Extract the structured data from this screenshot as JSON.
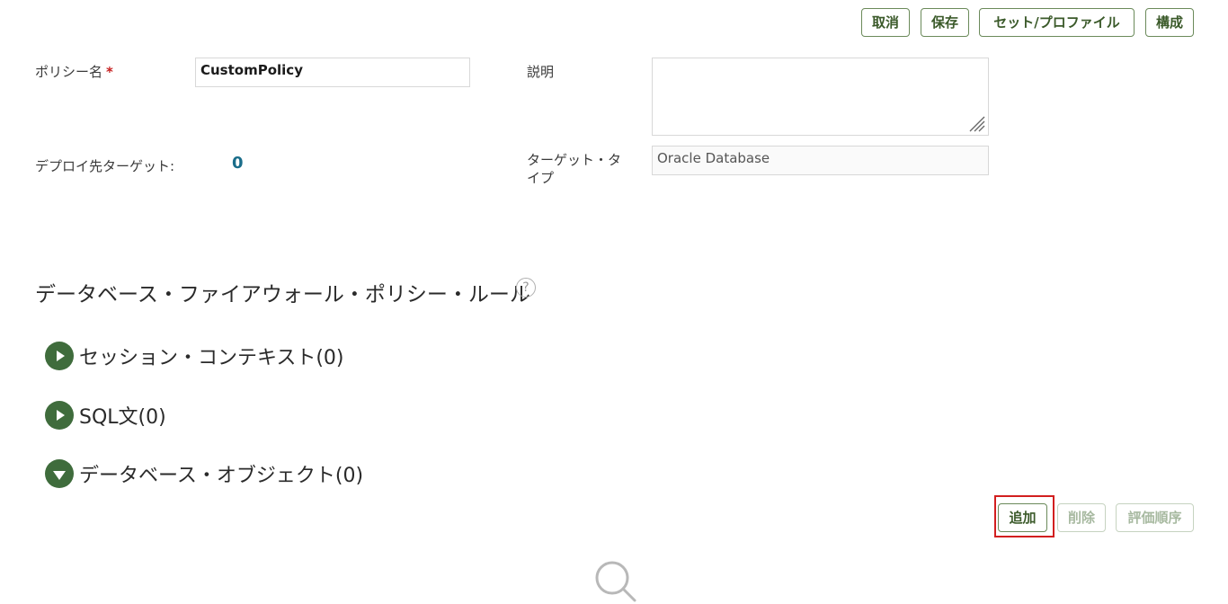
{
  "toolbar": {
    "cancel_label": "取消",
    "save_label": "保存",
    "set_profile_label": "セット/プロファイル",
    "configure_label": "構成"
  },
  "form": {
    "policy_name_label": "ポリシー名",
    "required_mark": "*",
    "policy_name_value": "CustomPolicy",
    "description_label": "説明",
    "description_value": "",
    "deploy_targets_label": "デプロイ先ターゲット:",
    "deploy_targets_value": "0",
    "target_type_label_line1": "ターゲット・タ",
    "target_type_label_line2": "イプ",
    "target_type_value": "Oracle Database"
  },
  "rules": {
    "title": "データベース・ファイアウォール・ポリシー・ルール",
    "help_icon": "question-circle-icon",
    "sections": [
      {
        "label": "セッション・コンテキスト(0)",
        "expanded": false
      },
      {
        "label": "SQL文(0)",
        "expanded": false
      },
      {
        "label": "データベース・オブジェクト(0)",
        "expanded": true
      }
    ]
  },
  "object_actions": {
    "add_label": "追加",
    "delete_label": "削除",
    "eval_order_label": "評価順序"
  },
  "colors": {
    "accent_green": "#3f6c3c",
    "link_blue": "#1a6d8a",
    "highlight_red": "#d21f1f"
  }
}
